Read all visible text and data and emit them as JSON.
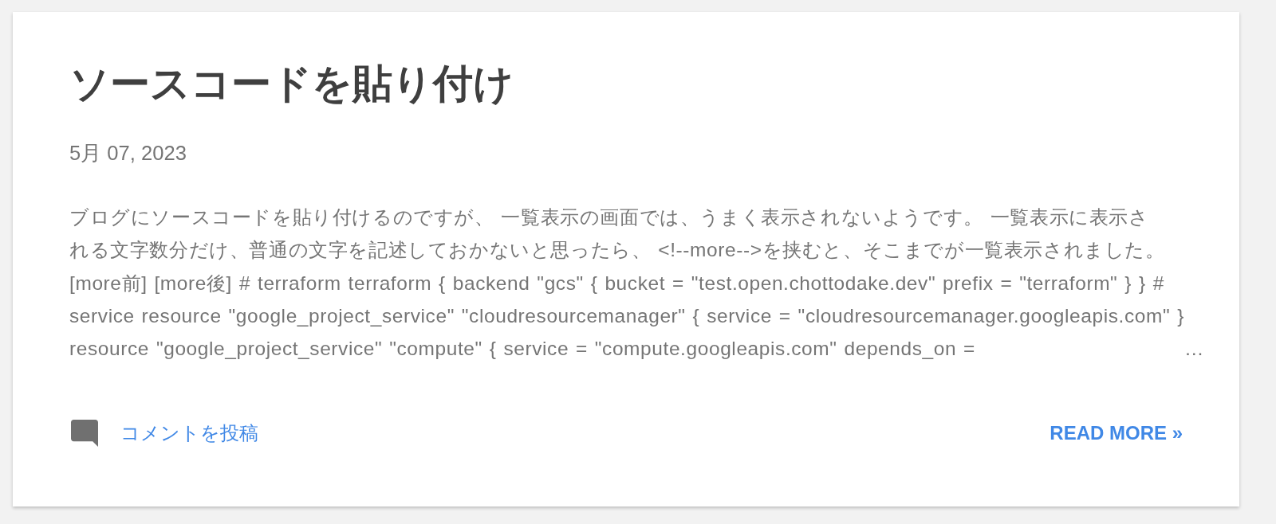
{
  "post": {
    "title": "ソースコードを貼り付け",
    "date": "5月 07, 2023",
    "snippet_lines": [
      "ブログにソースコードを貼り付けるのですが、 一覧表示の画面では、うまく表示されないようです。 一覧表示に表示さ",
      "れる文字数分だけ、普通の文字を記述しておかないと思ったら、 <!--more-->を挟むと、そこまでが一覧表示されました。",
      "[more前] [more後] # terraform terraform { backend \"gcs\" { bucket = \"test.open.chottodake.dev\" prefix = \"terraform\" } } #",
      "service resource \"google_project_service\" \"cloudresourcemanager\" { service = \"cloudresourcemanager.googleapis.com\" }",
      "resource \"google_project_service\" \"compute\" { service = \"compute.googleapis.com\" depends_on ="
    ],
    "snippet_ellipsis": "…"
  },
  "footer": {
    "comment_link": "コメントを投稿",
    "read_more": "READ MORE »"
  }
}
